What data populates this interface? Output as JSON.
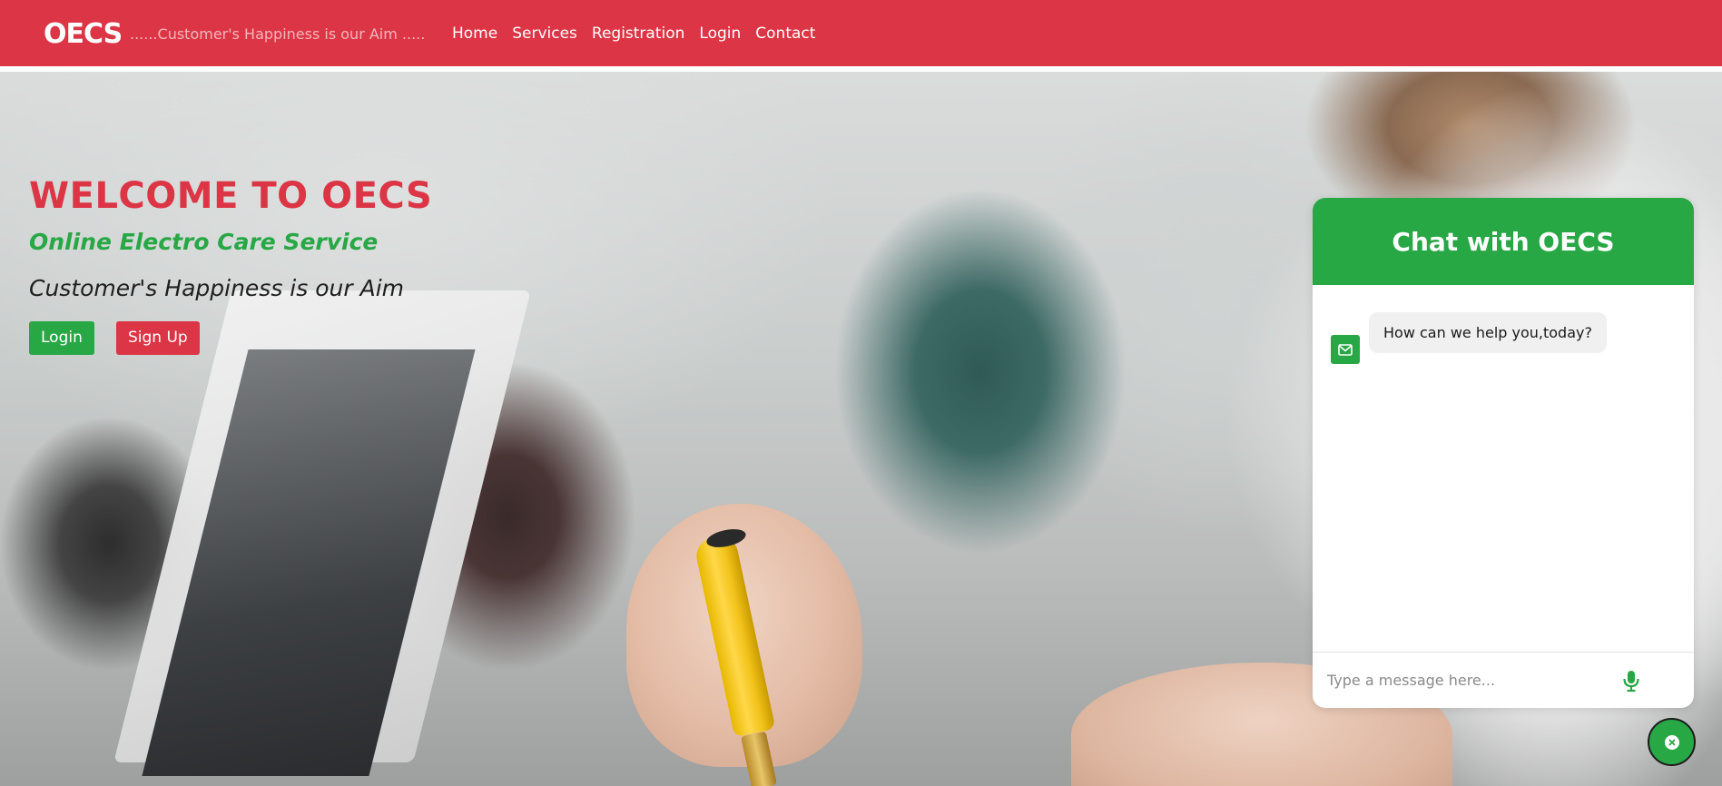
{
  "navbar": {
    "brand": "OECS",
    "tagline": "......Customer's Happiness is our Aim .....",
    "links": [
      {
        "label": "Home"
      },
      {
        "label": "Services"
      },
      {
        "label": "Registration"
      },
      {
        "label": "Login"
      },
      {
        "label": "Contact"
      }
    ]
  },
  "hero": {
    "title": "WELCOME TO OECS",
    "subtitle": "Online Electro Care Service",
    "tagline": "Customer's Happiness is our Aim",
    "login_label": "Login",
    "signup_label": "Sign Up"
  },
  "chat": {
    "title": "Chat with OECS",
    "bot_icon": "envelope-icon",
    "message": "How can we help you,today?",
    "input_placeholder": "Type a message here...",
    "mic_icon": "microphone-icon",
    "toggle_icon": "close-icon"
  },
  "colors": {
    "brand_red": "#dc3545",
    "brand_green": "#28a745"
  }
}
